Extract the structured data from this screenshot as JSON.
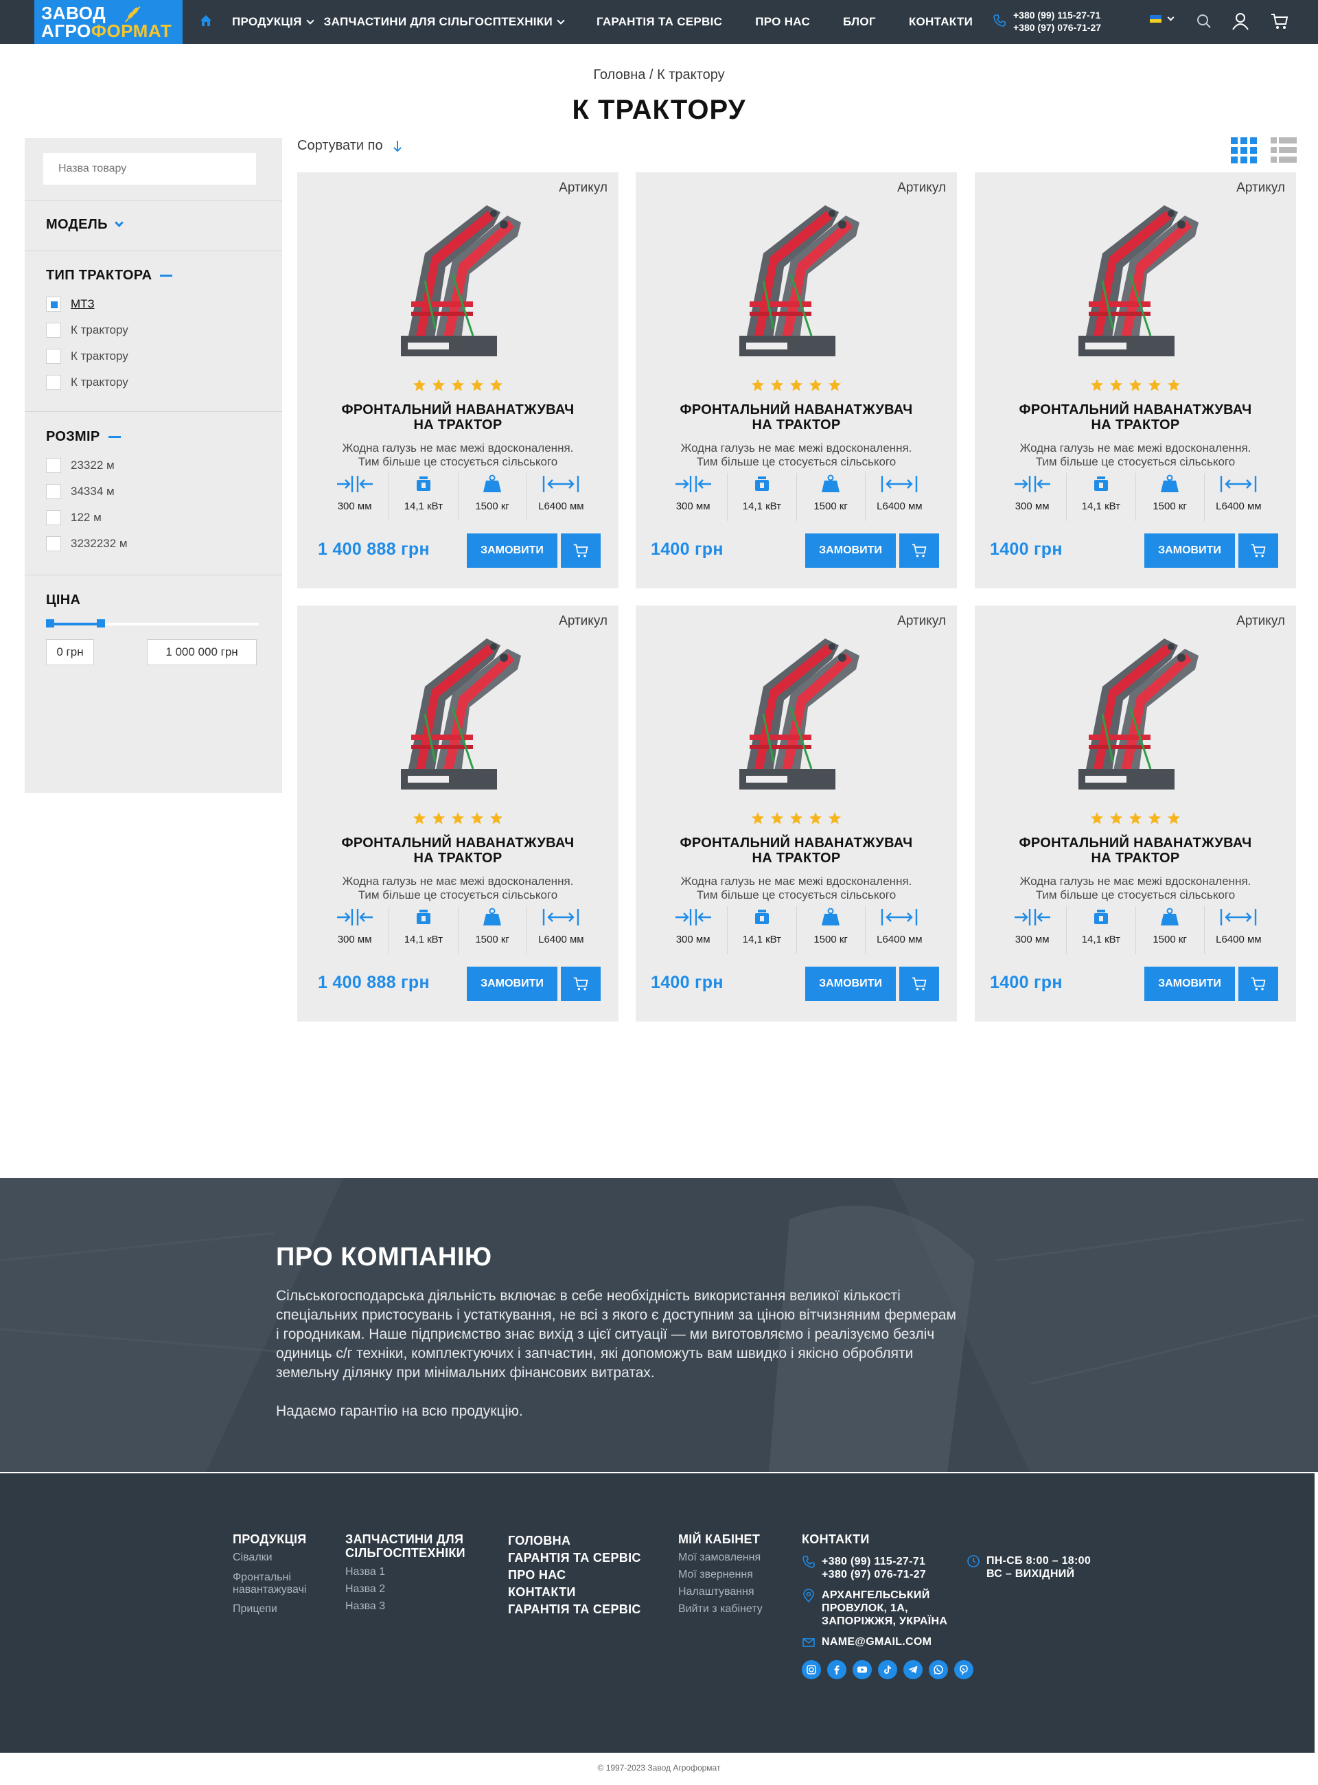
{
  "header": {
    "logo_line1": "ЗАВОД",
    "logo_line2_a": "АГРО",
    "logo_line2_b": "ФОРМАТ",
    "nav": [
      "ПРОДУКЦІЯ",
      "ЗАПЧАСТИНИ ДЛЯ СІЛЬГОСПТЕХНІКИ",
      "ГАРАНТІЯ ТА СЕРВІС",
      "ПРО НАС",
      "БЛОГ",
      "КОНТАКТИ"
    ],
    "phone1": "+380 (99) 115-27-71",
    "phone2": "+380 (97) 076-71-27",
    "icons": [
      "home-icon",
      "phone-icon",
      "flag-ua-icon",
      "search-icon",
      "user-icon",
      "cart-icon"
    ]
  },
  "breadcrumb": {
    "home": "Головна",
    "sep": "/",
    "current": "К трактору"
  },
  "page_title": "К ТРАКТОРУ",
  "sidebar": {
    "search_placeholder": "Назва товару",
    "model_title": "МОДЕЛЬ",
    "tractor_type_title": "ТИП ТРАКТОРА",
    "tractor_types": [
      {
        "label": "МТЗ",
        "checked": true
      },
      {
        "label": "К трактору",
        "checked": false
      },
      {
        "label": "К трактору",
        "checked": false
      },
      {
        "label": "К трактору",
        "checked": false
      }
    ],
    "size_title": "РОЗМІР",
    "sizes": [
      "23322 м",
      "34334 м",
      "122 м",
      "3232232 м"
    ],
    "price_title": "ЦІНА",
    "price_min": "0 грн",
    "price_max": "1 000 000 грн",
    "range_fill_fraction": 0.24
  },
  "toolbar": {
    "sort_label": "Сортувати по",
    "view_mode": "grid"
  },
  "products": [
    {
      "article": "Артикул",
      "rating": 5,
      "title_line1": "ФРОНТАЛЬНИЙ НАВАНАТЖУВАЧ",
      "title_line2": "НА ТРАКТОР",
      "desc_line1": "Жодна галузь не має межі вдосконалення.",
      "desc_line2": "Тим більше це стосується сільського",
      "spec_width": "300 мм",
      "spec_power": "14,1 кВт",
      "spec_weight": "1500 кг",
      "spec_length": "L6400 мм",
      "price": "1 400 888 грн",
      "order": "ЗАМОВИТИ"
    },
    {
      "article": "Артикул",
      "rating": 5,
      "title_line1": "ФРОНТАЛЬНИЙ НАВАНАТЖУВАЧ",
      "title_line2": "НА ТРАКТОР",
      "desc_line1": "Жодна галузь не має межі вдосконалення.",
      "desc_line2": "Тим більше це стосується сільського",
      "spec_width": "300 мм",
      "spec_power": "14,1 кВт",
      "spec_weight": "1500 кг",
      "spec_length": "L6400 мм",
      "price": "1400 грн",
      "order": "ЗАМОВИТИ"
    },
    {
      "article": "Артикул",
      "rating": 5,
      "title_line1": "ФРОНТАЛЬНИЙ НАВАНАТЖУВАЧ",
      "title_line2": "НА ТРАКТОР",
      "desc_line1": "Жодна галузь не має межі вдосконалення.",
      "desc_line2": "Тим більше це стосується сільського",
      "spec_width": "300 мм",
      "spec_power": "14,1 кВт",
      "spec_weight": "1500 кг",
      "spec_length": "L6400 мм",
      "price": "1400 грн",
      "order": "ЗАМОВИТИ"
    },
    {
      "article": "Артикул",
      "rating": 5,
      "title_line1": "ФРОНТАЛЬНИЙ НАВАНАТЖУВАЧ",
      "title_line2": "НА ТРАКТОР",
      "desc_line1": "Жодна галузь не має межі вдосконалення.",
      "desc_line2": "Тим більше це стосується сільського",
      "spec_width": "300 мм",
      "spec_power": "14,1 кВт",
      "spec_weight": "1500 кг",
      "spec_length": "L6400 мм",
      "price": "1 400 888 грн",
      "order": "ЗАМОВИТИ"
    },
    {
      "article": "Артикул",
      "rating": 5,
      "title_line1": "ФРОНТАЛЬНИЙ НАВАНАТЖУВАЧ",
      "title_line2": "НА ТРАКТОР",
      "desc_line1": "Жодна галузь не має межі вдосконалення.",
      "desc_line2": "Тим більше це стосується сільського",
      "spec_width": "300 мм",
      "spec_power": "14,1 кВт",
      "spec_weight": "1500 кг",
      "spec_length": "L6400 мм",
      "price": "1400 грн",
      "order": "ЗАМОВИТИ"
    },
    {
      "article": "Артикул",
      "rating": 5,
      "title_line1": "ФРОНТАЛЬНИЙ НАВАНАТЖУВАЧ",
      "title_line2": "НА ТРАКТОР",
      "desc_line1": "Жодна галузь не має межі вдосконалення.",
      "desc_line2": "Тим більше це стосується сільського",
      "spec_width": "300 мм",
      "spec_power": "14,1 кВт",
      "spec_weight": "1500 кг",
      "spec_length": "L6400 мм",
      "price": "1400 грн",
      "order": "ЗАМОВИТИ"
    }
  ],
  "about": {
    "title": "ПРО КОМПАНІЮ",
    "lines": [
      "Сільськогосподарська діяльність включає в себе необхідність використання великої кількості",
      "спеціальних пристосувань і устаткування, не всі з якого є доступним за ціною вітчизняним фермерам",
      "і городникам. Наше підприємство знає вихід з цієї ситуації — ми виготовляємо і реалізуємо безліч",
      "одиниць с/г техніки, комплектуючих і запчастин, які допоможуть вам швидко і якісно обробляти",
      "земельну ділянку при мінімальних фінансових витратах."
    ],
    "guarantee": "Надаємо гарантію на всю продукцію."
  },
  "footer": {
    "products_title": "ПРОДУКЦІЯ",
    "products_links": [
      "Сівалки",
      "Фронтальні",
      "навантажувачі",
      "Прицепи"
    ],
    "parts_title_1": "ЗАПЧАСТИНИ ДЛЯ",
    "parts_title_2": "СІЛЬГОСПТЕХНІКИ",
    "parts_links": [
      "Назва 1",
      "Назва 2",
      "Назва 3"
    ],
    "main_links": [
      "ГОЛОВНА",
      "ГАРАНТІЯ ТА СЕРВІС",
      "ПРО НАС",
      "КОНТАКТИ",
      "ГАРАНТІЯ ТА СЕРВІС"
    ],
    "cabinet_title": "МІЙ КАБІНЕТ",
    "cabinet_links": [
      "Мої замовлення",
      "Мої звернення",
      "Налаштування",
      "Вийти з кабінету"
    ],
    "contacts_title": "КОНТАКТИ",
    "phone1": "+380 (99) 115-27-71",
    "phone2": "+380 (97) 076-71-27",
    "address_1": "АРХАНГЕЛЬСЬКИЙ",
    "address_2": "ПРОВУЛОК, 1А,",
    "address_3": "ЗАПОРІЖЖЯ, УКРАЇНА",
    "email": "NAME@GMAIL.COM",
    "hours_1": "ПН-СБ  8:00 – 18:00",
    "hours_2": "ВС – ВИХІДНИЙ",
    "social": [
      "instagram-icon",
      "facebook-icon",
      "youtube-icon",
      "tiktok-icon",
      "telegram-icon",
      "whatsapp-icon",
      "viber-icon"
    ],
    "copyright": "© 1997-2023 Завод Агроформат"
  },
  "colors": {
    "accent": "#1f8ce8",
    "header_bg": "#2f3a44",
    "card_bg": "#ececec",
    "star": "#f6b51e",
    "loader_red": "#d8283a"
  }
}
